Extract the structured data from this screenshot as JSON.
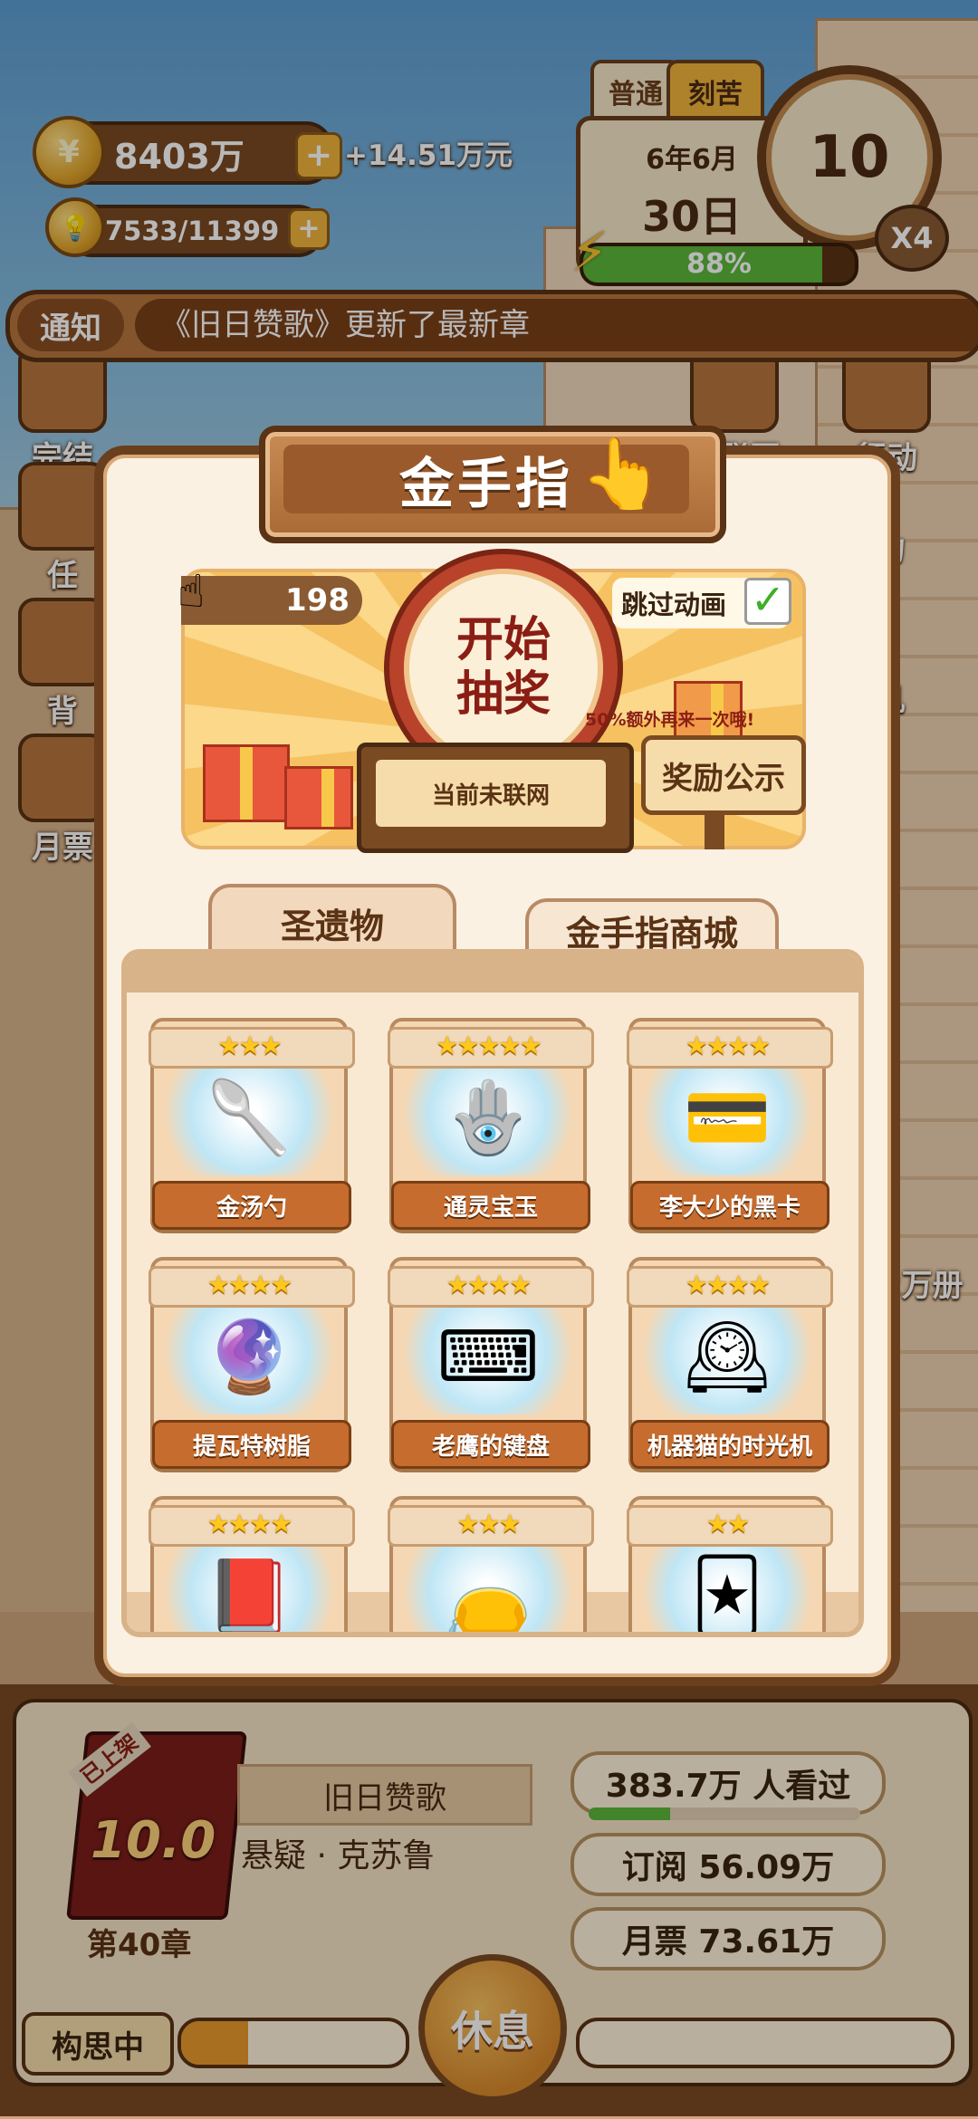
{
  "hud": {
    "coins": "8403万",
    "coin_gain": "+14.51万元",
    "inspiration": "7533/11399",
    "difficulty_tabs": [
      "普通",
      "刻苦"
    ],
    "date_month": "6年6月",
    "date_day": "30日",
    "clock_value": "10",
    "speed": "X4",
    "energy_percent": "88%",
    "energy_fraction": 0.88
  },
  "notice": {
    "label": "通知",
    "text": "《旧日赞歌》更新了最新章"
  },
  "side_left": [
    "完结",
    "任",
    "背",
    "月票"
  ],
  "side_right": [
    "未联网",
    "行动",
    "物",
    "机"
  ],
  "side_partial_text": "2万册",
  "modal": {
    "title": "金手指",
    "tickets": "198",
    "draw_button": "开始\n抽奖",
    "stand_text": "当前未联网",
    "skip_animation": "跳过动画",
    "skip_checked": true,
    "bonus_text": "50%额外再来一次哦!",
    "reward_button": "奖励公示",
    "tabs": [
      "圣遗物",
      "金手指商城"
    ],
    "active_tab": 0,
    "items": [
      {
        "name": "金汤勺",
        "stars": 3,
        "icon": "golden-spoon-icon"
      },
      {
        "name": "通灵宝玉",
        "stars": 5,
        "icon": "jade-pendant-icon"
      },
      {
        "name": "李大少的黑卡",
        "stars": 4,
        "icon": "vip-card-icon"
      },
      {
        "name": "提瓦特树脂",
        "stars": 4,
        "icon": "resin-orb-icon"
      },
      {
        "name": "老鹰的键盘",
        "stars": 4,
        "icon": "keyboard-icon"
      },
      {
        "name": "机器猫的时光机",
        "stars": 4,
        "icon": "time-machine-icon"
      },
      {
        "name": "",
        "stars": 4,
        "icon": "book-icon"
      },
      {
        "name": "",
        "stars": 3,
        "icon": "bag-icon"
      },
      {
        "name": "",
        "stars": 2,
        "icon": "card-icon"
      }
    ]
  },
  "book": {
    "badge": "已上架",
    "score": "10.0",
    "chapter": "第40章",
    "title": "旧日赞歌",
    "genre": "悬疑 · 克苏鲁",
    "views": "383.7万 人看过",
    "views_fraction": 0.3,
    "subscriptions": "订阅  56.09万",
    "monthly_tickets": "月票  73.61万",
    "rest_button": "休息",
    "thinking_label": "构思中",
    "thinking_progress": 0.3
  }
}
